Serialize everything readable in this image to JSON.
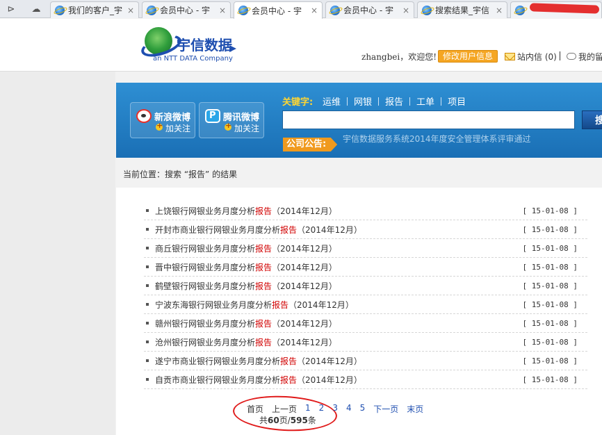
{
  "browser": {
    "nav_icons": [
      "sidebar-toggle-icon",
      "cloud-icon"
    ],
    "tabs": [
      {
        "title": "我们的客户_宇",
        "active": false
      },
      {
        "title": "会员中心 - 宇",
        "active": false
      },
      {
        "title": "会员中心 - 宇",
        "active": true
      },
      {
        "title": "会员中心 - 宇",
        "active": false
      },
      {
        "title": "搜索结果_宇信",
        "active": false
      }
    ],
    "close_glyph": "×"
  },
  "header": {
    "logo_title": "宇信数据",
    "logo_subtitle": "an NTT DATA Company",
    "welcome": "zhangbei，欢迎您!",
    "modify_button": "修改用户信息",
    "inbox": "站内信 (0)",
    "my_reply": "我的留"
  },
  "banner": {
    "weibo": [
      {
        "name": "新浪微博",
        "follow": "加关注"
      },
      {
        "name": "腾讯微博",
        "follow": "加关注"
      }
    ],
    "keywords_label": "关键字:",
    "keywords": [
      "运维",
      "网银",
      "报告",
      "工单",
      "项目"
    ],
    "search_value": "",
    "search_button": "搜",
    "notice_label": "公司公告:",
    "notice_text": "宇信数据服务系统2014年度安全管理体系评审通过"
  },
  "breadcrumb": "当前位置：搜索 “报告” 的结果",
  "results": [
    {
      "prefix": "上饶银行网银业务月度分析",
      "highlight": "报告",
      "suffix": "（2014年12月）",
      "date": "[ 15-01-08 ]"
    },
    {
      "prefix": "开封市商业银行网银业务月度分析",
      "highlight": "报告",
      "suffix": "（2014年12月）",
      "date": "[ 15-01-08 ]"
    },
    {
      "prefix": "商丘银行网银业务月度分析",
      "highlight": "报告",
      "suffix": "（2014年12月）",
      "date": "[ 15-01-08 ]"
    },
    {
      "prefix": "晋中银行网银业务月度分析",
      "highlight": "报告",
      "suffix": "（2014年12月）",
      "date": "[ 15-01-08 ]"
    },
    {
      "prefix": "鹤壁银行网银业务月度分析",
      "highlight": "报告",
      "suffix": "（2014年12月）",
      "date": "[ 15-01-08 ]"
    },
    {
      "prefix": "宁波东海银行网银业务月度分析",
      "highlight": "报告",
      "suffix": "（2014年12月）",
      "date": "[ 15-01-08 ]"
    },
    {
      "prefix": "赣州银行网银业务月度分析",
      "highlight": "报告",
      "suffix": "（2014年12月）",
      "date": "[ 15-01-08 ]"
    },
    {
      "prefix": "沧州银行网银业务月度分析",
      "highlight": "报告",
      "suffix": "（2014年12月）",
      "date": "[ 15-01-08 ]"
    },
    {
      "prefix": "遂宁市商业银行网银业务月度分析",
      "highlight": "报告",
      "suffix": "（2014年12月）",
      "date": "[ 15-01-08 ]"
    },
    {
      "prefix": "自贡市商业银行网银业务月度分析",
      "highlight": "报告",
      "suffix": "（2014年12月）",
      "date": "[ 15-01-08 ]"
    }
  ],
  "pager": {
    "first": "首页",
    "prev": "上一页",
    "pages": [
      "1",
      "2",
      "3",
      "4",
      "5"
    ],
    "next": "下一页",
    "last": "末页",
    "total_prefix": "共",
    "total_pages": "60",
    "total_mid": "页/",
    "total_items": "595",
    "total_suffix": "条"
  },
  "colors": {
    "banner_blue": "#1a6fb5",
    "highlight_red": "#d10000",
    "link_blue": "#1f4fb0",
    "notice_orange": "#f09a1e"
  }
}
